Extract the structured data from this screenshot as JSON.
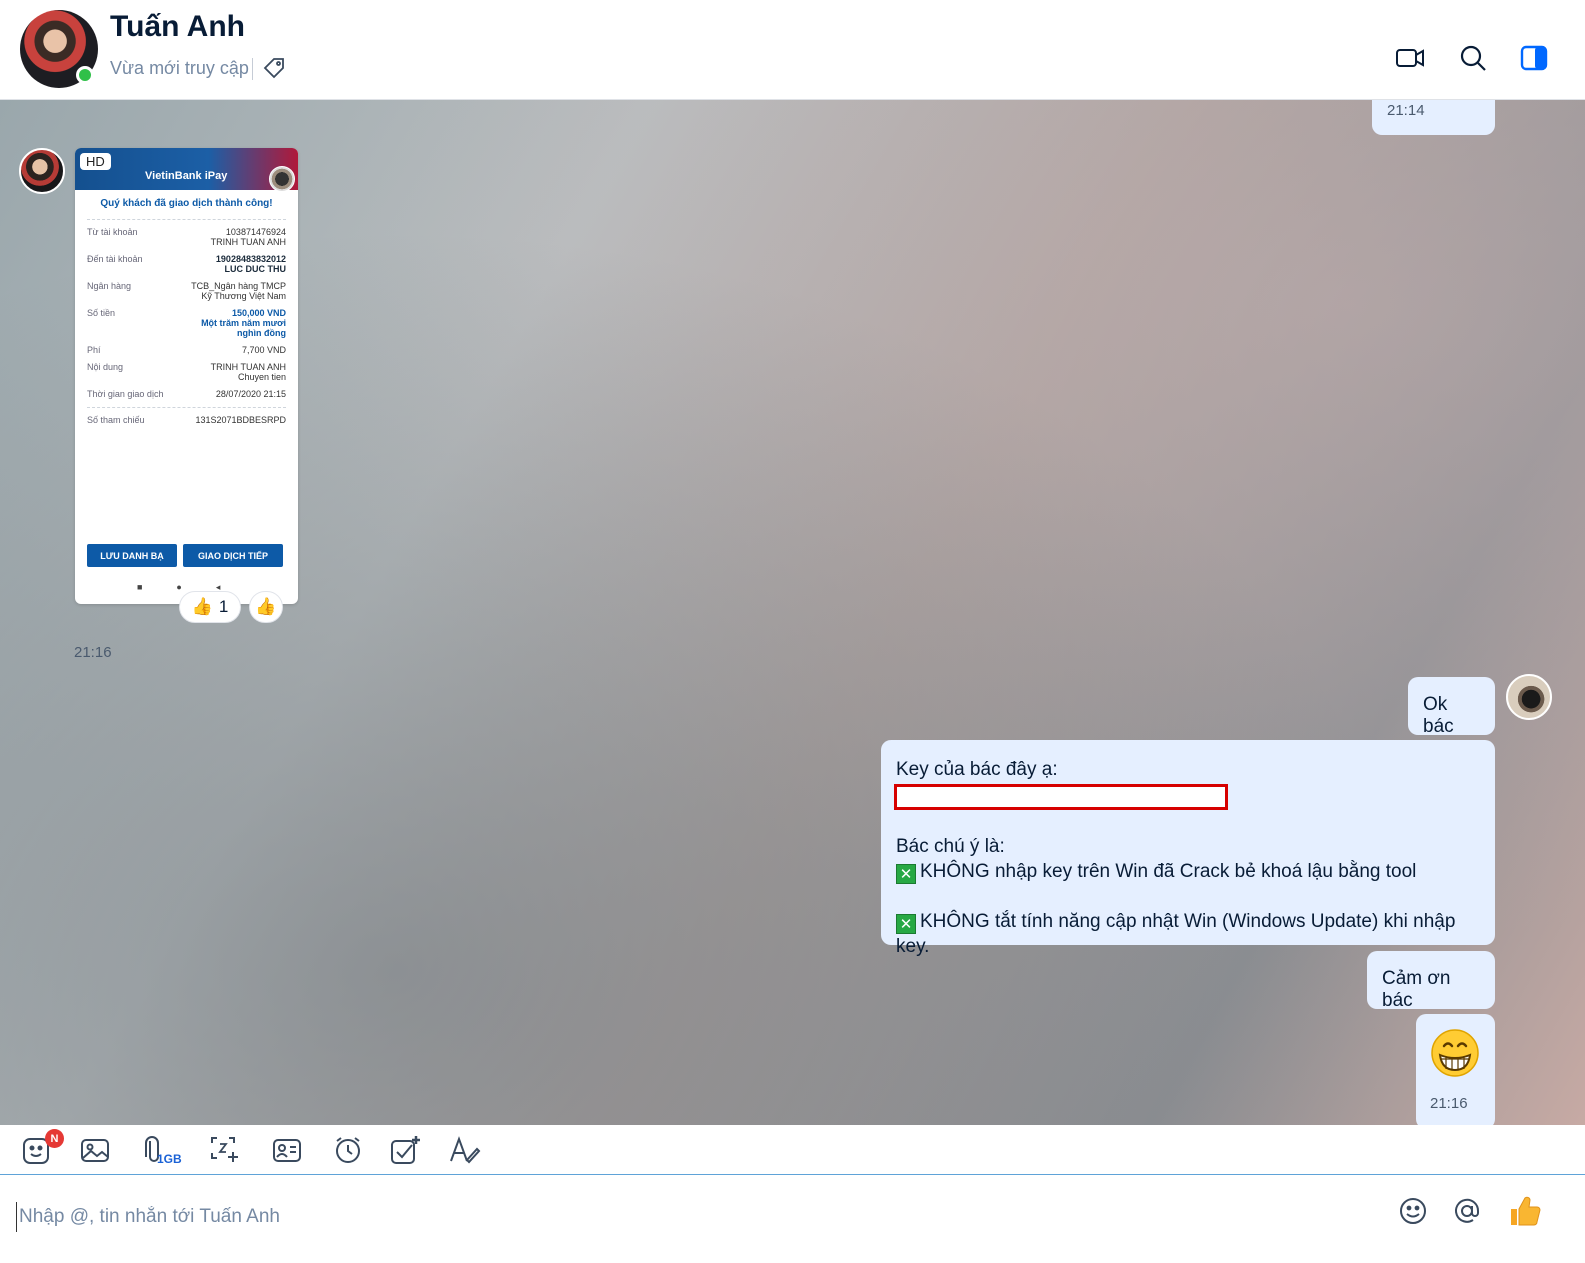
{
  "header": {
    "contact_name": "Tuấn Anh",
    "status": "Vừa mới truy cập",
    "icons": [
      "tag-icon",
      "video-call-icon",
      "search-icon",
      "sidebar-toggle-icon"
    ]
  },
  "messages": {
    "top_time": "21:14",
    "receipt": {
      "hd_badge": "HD",
      "brand": "VietinBank iPay",
      "success": "Quý khách đã giao dịch thành công!",
      "rows": [
        {
          "k": "Từ tài khoản",
          "v1": "103871476924",
          "v2": "TRINH TUAN ANH"
        },
        {
          "k": "Đến tài khoản",
          "v1": "19028483832012",
          "v2": "LUC DUC THU"
        },
        {
          "k": "Ngân hàng",
          "v1": "TCB_Ngân hàng TMCP",
          "v2": "Kỹ Thương Việt Nam"
        },
        {
          "k": "Số tiền",
          "v1": "150,000 VND",
          "v2": "Một trăm năm mươi",
          "v3": "nghìn đồng"
        },
        {
          "k": "Phí",
          "v1": "7,700 VND"
        },
        {
          "k": "Nội dung",
          "v1": "TRINH TUAN ANH",
          "v2": "Chuyen tien"
        },
        {
          "k": "Thời gian giao dịch",
          "v1": "28/07/2020 21:15"
        },
        {
          "k": "Số tham chiếu",
          "v1": "131S2071BDBESRPD"
        }
      ],
      "btn_save": "LƯU DANH BẠ",
      "btn_continue": "GIAO DỊCH TIẾP"
    },
    "reaction_count": "1",
    "receipt_time": "21:16",
    "ok_text": "Ok bác",
    "key_line": "Key của bác đây ạ:",
    "note_title": "Bác chú ý là:",
    "note_1": "KHÔNG nhập key trên Win đã Crack bẻ khoá lậu bằng tool",
    "note_2": "KHÔNG tắt tính năng cập nhật Win (Windows Update) khi nhập key.",
    "x_mark": "✕",
    "thanks_text": "Cảm ơn bác",
    "emoji_time": "21:16"
  },
  "toolbar": {
    "sticker_badge": "N",
    "file_limit": "1GB",
    "icons": [
      "sticker-icon",
      "image-icon",
      "attach-icon",
      "screenshot-icon",
      "contact-card-icon",
      "reminder-icon",
      "todo-icon",
      "format-text-icon"
    ]
  },
  "composer": {
    "placeholder": "Nhập @, tin nhắn tới Tuấn Anh",
    "value": ""
  }
}
